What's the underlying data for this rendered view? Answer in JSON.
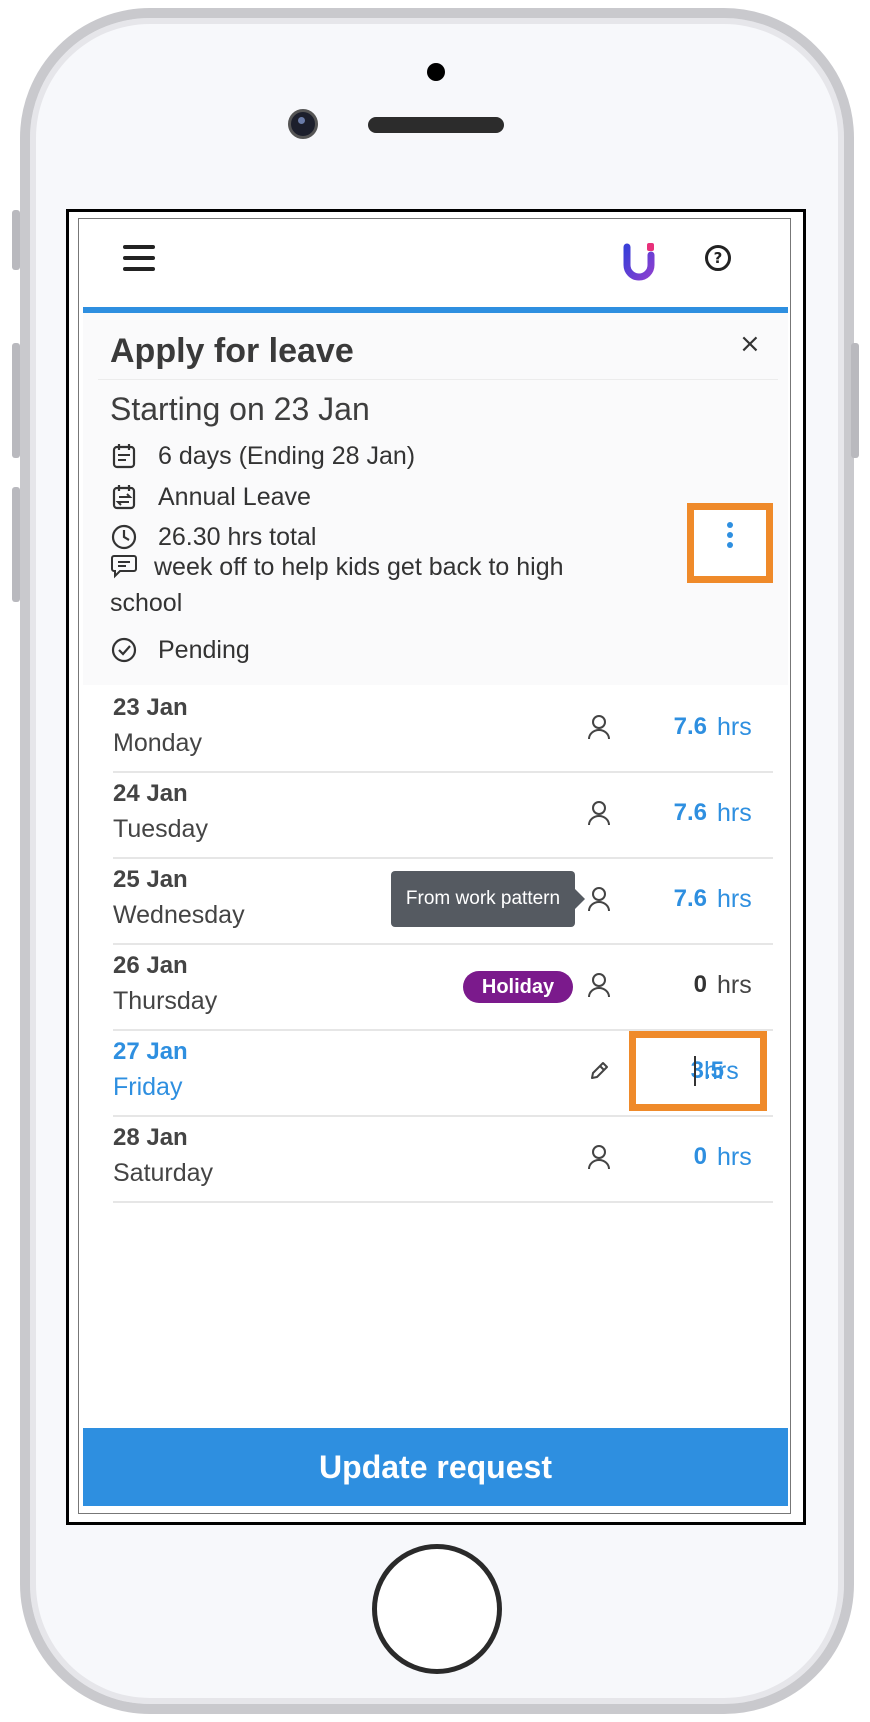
{
  "header": {
    "menu_icon": "hamburger-menu-icon",
    "help_icon": "question-circle-icon",
    "help_glyph": "?",
    "accent_color": "#2e8fe0",
    "highlight_color": "#ef8a2a"
  },
  "panel": {
    "title": "Apply for leave",
    "close_label": "×",
    "starting": "Starting on 23 Jan",
    "duration": "6 days (Ending 28 Jan)",
    "leave_type": "Annual Leave",
    "total": "26.30 hrs total",
    "comment": "week off to help kids get back to high school",
    "status": "Pending"
  },
  "days": [
    {
      "date": "23 Jan",
      "day": "Monday",
      "hours": "7.6",
      "unit": "hrs"
    },
    {
      "date": "24 Jan",
      "day": "Tuesday",
      "hours": "7.6",
      "unit": "hrs"
    },
    {
      "date": "25 Jan",
      "day": "Wednesday",
      "hours": "7.6",
      "unit": "hrs",
      "tooltip": "From work pattern"
    },
    {
      "date": "26 Jan",
      "day": "Thursday",
      "hours": "0",
      "unit": "hrs",
      "badge": "Holiday"
    },
    {
      "date": "27 Jan",
      "day": "Friday",
      "hours": "3.5",
      "unit": "hrs"
    },
    {
      "date": "28 Jan",
      "day": "Saturday",
      "hours": "0",
      "unit": "hrs"
    }
  ],
  "footer": {
    "update_label": "Update request"
  }
}
